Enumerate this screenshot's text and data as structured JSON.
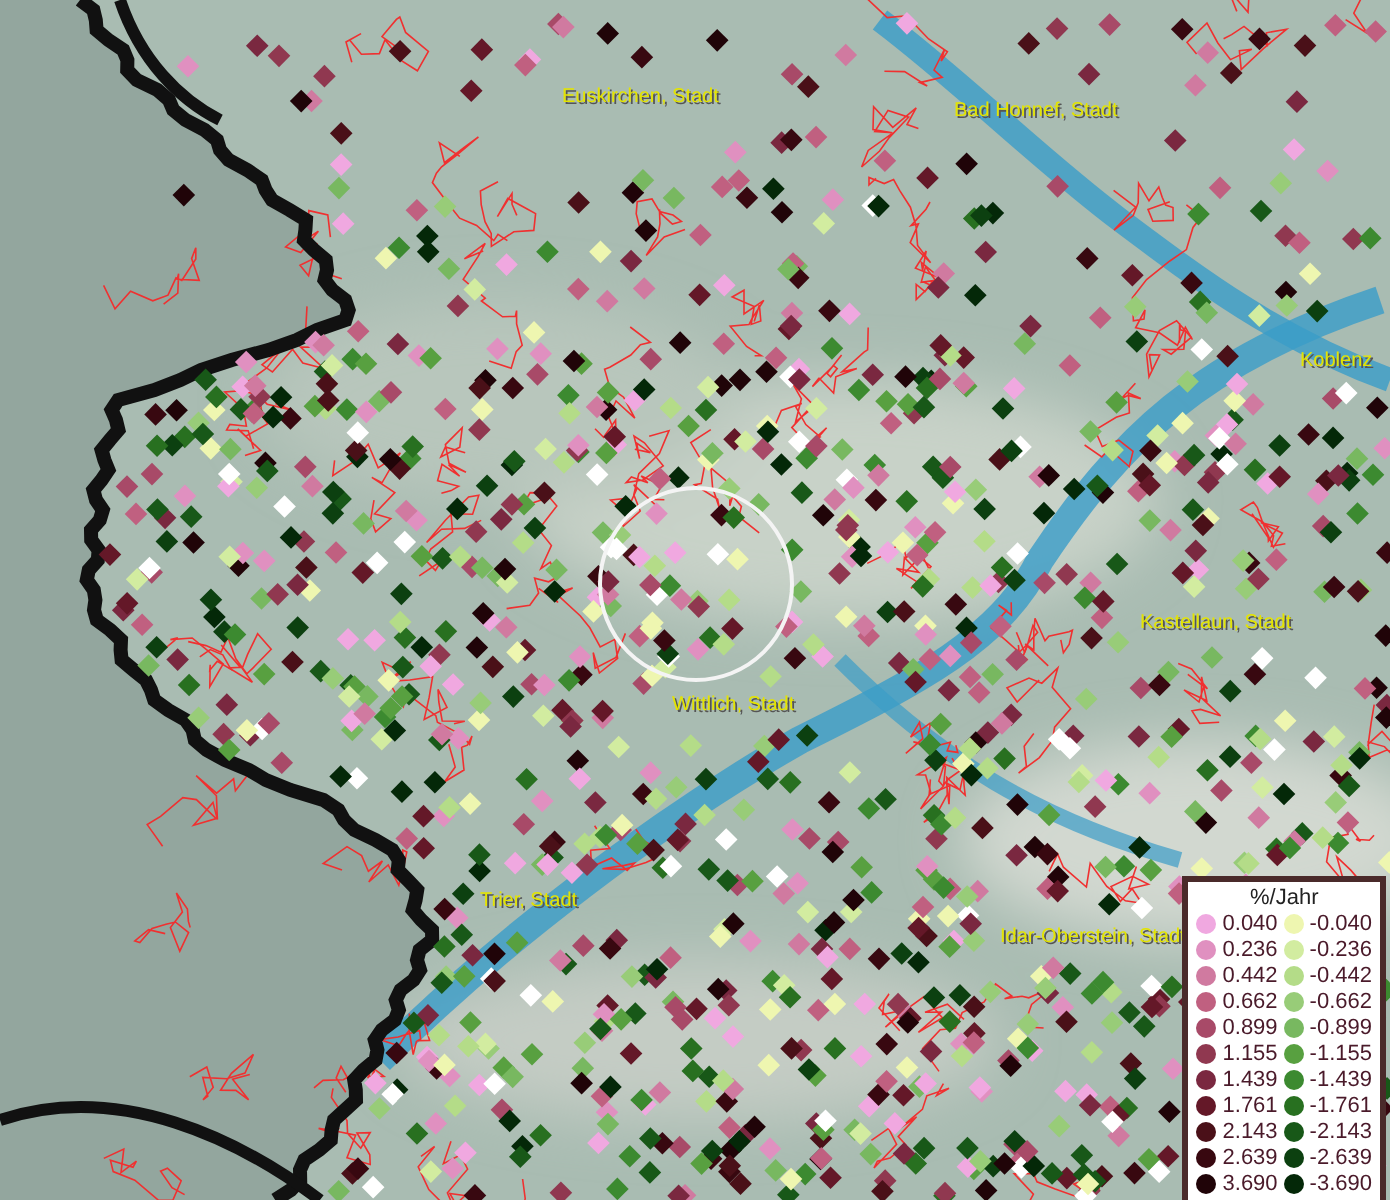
{
  "map": {
    "places": [
      {
        "name": "Euskirchen, Stadt"
      },
      {
        "name": "Bad Honnef, Stadt"
      },
      {
        "name": "Koblenz"
      },
      {
        "name": "Kastellaun, Stadt"
      },
      {
        "name": "Wittlich, Stadt"
      },
      {
        "name": "Trier, Stadt"
      },
      {
        "name": "Idar-Oberstein, Stadt"
      }
    ]
  },
  "legend": {
    "title": "%/Jahr",
    "rows": [
      {
        "positive": {
          "value": "0.040",
          "color": "#f0a8e0"
        },
        "negative": {
          "value": "-0.040",
          "color": "#eef6b0"
        }
      },
      {
        "positive": {
          "value": "0.236",
          "color": "#e090c0"
        },
        "negative": {
          "value": "-0.236",
          "color": "#d2eca0"
        }
      },
      {
        "positive": {
          "value": "0.442",
          "color": "#d07aa0"
        },
        "negative": {
          "value": "-0.442",
          "color": "#b4dc88"
        }
      },
      {
        "positive": {
          "value": "0.662",
          "color": "#c06080"
        },
        "negative": {
          "value": "-0.662",
          "color": "#98cc78"
        }
      },
      {
        "positive": {
          "value": "0.899",
          "color": "#a84a68"
        },
        "negative": {
          "value": "-0.899",
          "color": "#78b860"
        }
      },
      {
        "positive": {
          "value": "1.155",
          "color": "#903850"
        },
        "negative": {
          "value": "-1.155",
          "color": "#58a040"
        }
      },
      {
        "positive": {
          "value": "1.439",
          "color": "#7a2840"
        },
        "negative": {
          "value": "-1.439",
          "color": "#3c8a30"
        }
      },
      {
        "positive": {
          "value": "1.761",
          "color": "#641828"
        },
        "negative": {
          "value": "-1.761",
          "color": "#287020"
        }
      },
      {
        "positive": {
          "value": "2.143",
          "color": "#4a1018"
        },
        "negative": {
          "value": "-2.143",
          "color": "#185818"
        }
      },
      {
        "positive": {
          "value": "2.639",
          "color": "#380810"
        },
        "negative": {
          "value": "-2.639",
          "color": "#0c4010"
        }
      },
      {
        "positive": {
          "value": "3.690",
          "color": "#200408"
        },
        "negative": {
          "value": "-3.690",
          "color": "#042808"
        }
      }
    ]
  }
}
